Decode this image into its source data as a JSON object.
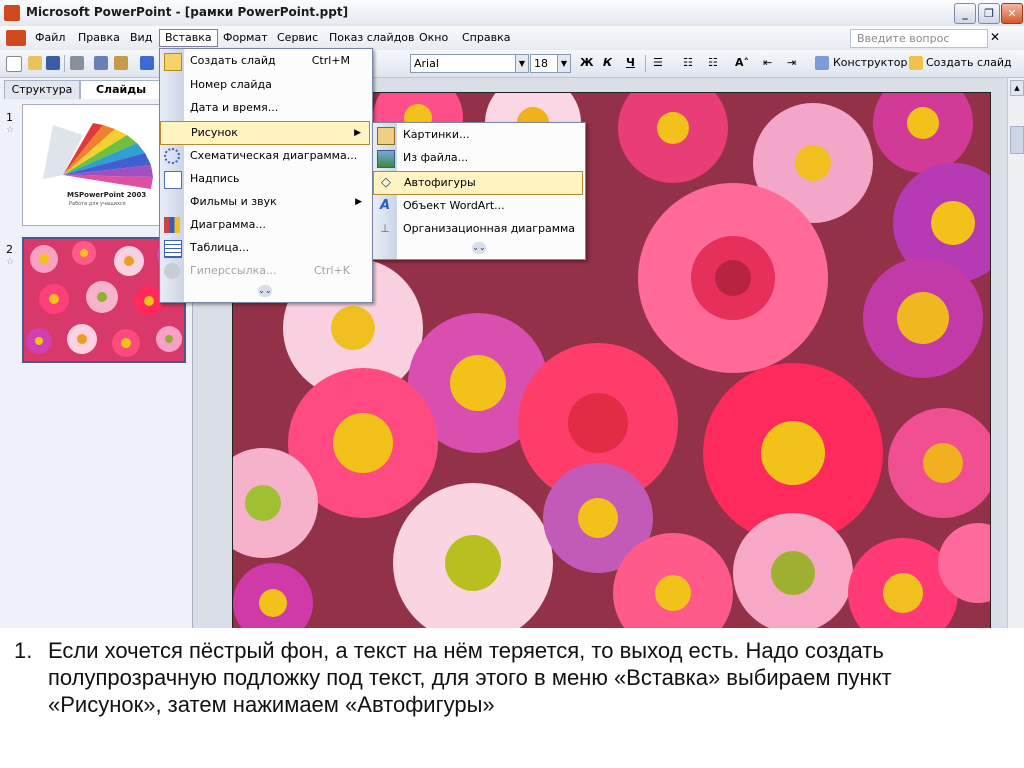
{
  "window": {
    "title": "Microsoft PowerPoint - [рамки PowerPoint.ppt]"
  },
  "menubar": {
    "items": [
      "Файл",
      "Правка",
      "Вид",
      "Вставка",
      "Формат",
      "Сервис",
      "Показ слайдов",
      "Окно",
      "Справка"
    ],
    "help_placeholder": "Введите вопрос"
  },
  "toolbar": {
    "font": "Arial",
    "size": "18",
    "bold": "Ж",
    "italic": "К",
    "underline": "Ч",
    "designer": "Конструктор",
    "new_slide": "Создать слайд"
  },
  "leftpanel": {
    "tabs": [
      "Структура",
      "Слайды"
    ],
    "slide1_num": "1",
    "slide2_num": "2",
    "slide1_title": "MSPowerPoint 2003",
    "slide1_subtitle": "Работа для учащихся"
  },
  "insert_menu": {
    "items": [
      {
        "label": "Создать слайд",
        "shortcut": "Ctrl+M",
        "icon": "new-slide-icon"
      },
      {
        "label": "Номер слайда",
        "shortcut": ""
      },
      {
        "label": "Дата и время...",
        "shortcut": ""
      },
      {
        "label": "Рисунок",
        "shortcut": "",
        "submenu": true
      },
      {
        "label": "Схематическая диаграмма...",
        "shortcut": "",
        "icon": "diagram-icon"
      },
      {
        "label": "Надпись",
        "shortcut": "",
        "icon": "textbox-icon"
      },
      {
        "label": "Фильмы и звук",
        "shortcut": "",
        "submenu": true
      },
      {
        "label": "Диаграмма...",
        "shortcut": "",
        "icon": "chart-icon"
      },
      {
        "label": "Таблица...",
        "shortcut": "",
        "icon": "table-icon"
      },
      {
        "label": "Гиперссылка...",
        "shortcut": "Ctrl+K",
        "icon": "hyperlink-icon",
        "disabled": true
      }
    ]
  },
  "picture_submenu": {
    "items": [
      {
        "label": "Картинки...",
        "icon": "clipart-icon"
      },
      {
        "label": "Из файла...",
        "icon": "from-file-icon"
      },
      {
        "label": "Автофигуры",
        "icon": "autoshapes-icon"
      },
      {
        "label": "Объект WordArt...",
        "icon": "wordart-icon"
      },
      {
        "label": "Организационная диаграмма",
        "icon": "org-chart-icon"
      }
    ]
  },
  "caption": {
    "number": "1.",
    "text": "Если хочется пёстрый фон, а текст на нём теряется, то выход есть. Надо создать полупрозрачную подложку под текст, для этого в меню «Вставка» выбираем пункт «Рисунок», затем нажимаем «Автофигуры»"
  },
  "colors": {
    "highlight": "#fff3c2",
    "highlight_border": "#b48a2e",
    "menu_strip": "#cbd5e6"
  }
}
